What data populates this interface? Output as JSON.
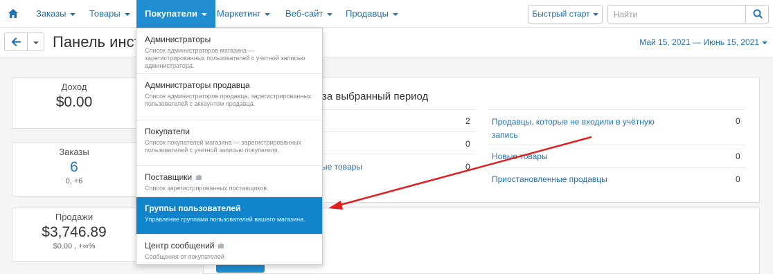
{
  "nav": {
    "items": [
      {
        "label": "Заказы"
      },
      {
        "label": "Товары"
      },
      {
        "label": "Покупатели"
      },
      {
        "label": "Маркетинг"
      },
      {
        "label": "Веб-сайт"
      },
      {
        "label": "Продавцы"
      }
    ],
    "quick_start": "Быстрый старт",
    "search_placeholder": "Найти"
  },
  "header": {
    "title": "Панель инст",
    "date_range": "Май 15, 2021 — Июнь 15, 2021"
  },
  "stats": {
    "income": {
      "label": "Доход",
      "value": "$0.00"
    },
    "orders": {
      "label": "Заказы",
      "value": "6",
      "sub": "0, +6"
    },
    "sales": {
      "label": "Продажи",
      "value": "$3,746.89",
      "sub": "$0.00 , +∞%"
    }
  },
  "panel": {
    "title": "з за выбранный период",
    "left_rows": [
      {
        "label": "",
        "value": "2"
      },
      {
        "label": "",
        "value": "0"
      },
      {
        "label": "ые товары",
        "value": "0"
      }
    ],
    "right_rows": [
      {
        "label": "Продавцы, которые не входили в учётную запись",
        "value": "0"
      },
      {
        "label": "Новые товары",
        "value": "0"
      },
      {
        "label": "Приостановленные продавцы",
        "value": "0"
      }
    ]
  },
  "dropdown": {
    "items": [
      {
        "title": "Администраторы",
        "desc": "Список администраторов магазина — зарегистрированных пользователей с учетной записью администратора."
      },
      {
        "title": "Администраторы продавца",
        "desc": "Список администраторов продавца, зарегистрированных пользователей с аккаунтом продавца."
      },
      {
        "title": "Покупатели",
        "desc": "Список покупателей магазина — зарегистрированных пользователей с учетной записью покупателя."
      },
      {
        "title": "Поставщики",
        "desc": "Список зарегистрированных поставщиков."
      },
      {
        "title": "Группы пользователей",
        "desc": "Управление группами пользователей вашего магазина."
      },
      {
        "title": "Центр сообщений",
        "desc": "Сообщения от покупателей"
      }
    ]
  },
  "colors": {
    "accent": "#1f8dd0",
    "active_item": "#1083cb",
    "link": "#1f73b7",
    "arrow": "#e02020"
  }
}
